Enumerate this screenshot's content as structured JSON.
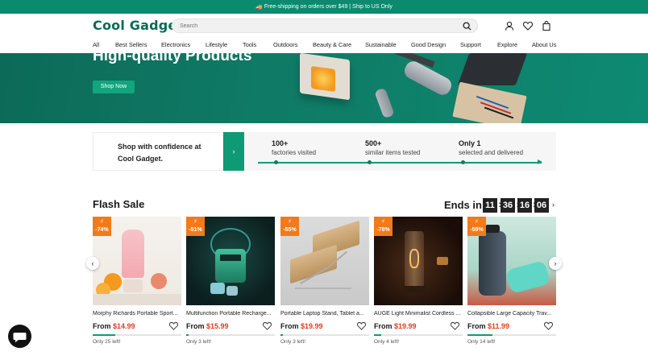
{
  "topbar": {
    "icon": "truck-icon",
    "text": "Free-shipping on orders over $49 | Ship to US Only"
  },
  "header": {
    "logo": "Cool Gadget",
    "search_placeholder": "Search"
  },
  "nav": [
    "All",
    "Best Sellers",
    "Electronics",
    "Lifestyle",
    "Tools",
    "Outdoors",
    "Beauty & Care",
    "Sustainable",
    "Good Design",
    "Support",
    "Explore",
    "About Us"
  ],
  "hero": {
    "title": "High-quality Products",
    "button": "Shop Now"
  },
  "confidence": {
    "text": "Shop with confidence at Cool Gadget.",
    "arrow": "›",
    "stats": [
      {
        "num": "100+",
        "label": "factories visited"
      },
      {
        "num": "500+",
        "label": "similar items tested"
      },
      {
        "num": "Only 1",
        "label": "selected and delivered"
      }
    ]
  },
  "flash": {
    "title": "Flash Sale",
    "ends_label": "Ends in",
    "timer": [
      "11",
      "36",
      "16",
      "06"
    ],
    "next": "›"
  },
  "products": [
    {
      "badge": "-74%",
      "name": "Morphy Richards Portable Sport...",
      "from": "From",
      "price": "$14.99",
      "left": "Only 25 left!",
      "stock": 0.25
    },
    {
      "badge": "-51%",
      "name": "Multifunction Portable Recharge...",
      "from": "From",
      "price": "$15.99",
      "left": "Only 3 left!",
      "stock": 0.03
    },
    {
      "badge": "-55%",
      "name": "Portable Laptop Stand, Tablet a...",
      "from": "From",
      "price": "$19.99",
      "left": "Only 3 left!",
      "stock": 0.03
    },
    {
      "badge": "-78%",
      "name": "AUGE Light Minimalist Cordless ...",
      "from": "From",
      "price": "$19.99",
      "left": "Only 4 left!",
      "stock": 0.08
    },
    {
      "badge": "-59%",
      "name": "Collapsible Large Capacity Trav...",
      "from": "From",
      "price": "$11.99",
      "left": "Only 14 left!",
      "stock": 0.28
    }
  ],
  "carousel": {
    "prev": "‹",
    "next": "›"
  }
}
